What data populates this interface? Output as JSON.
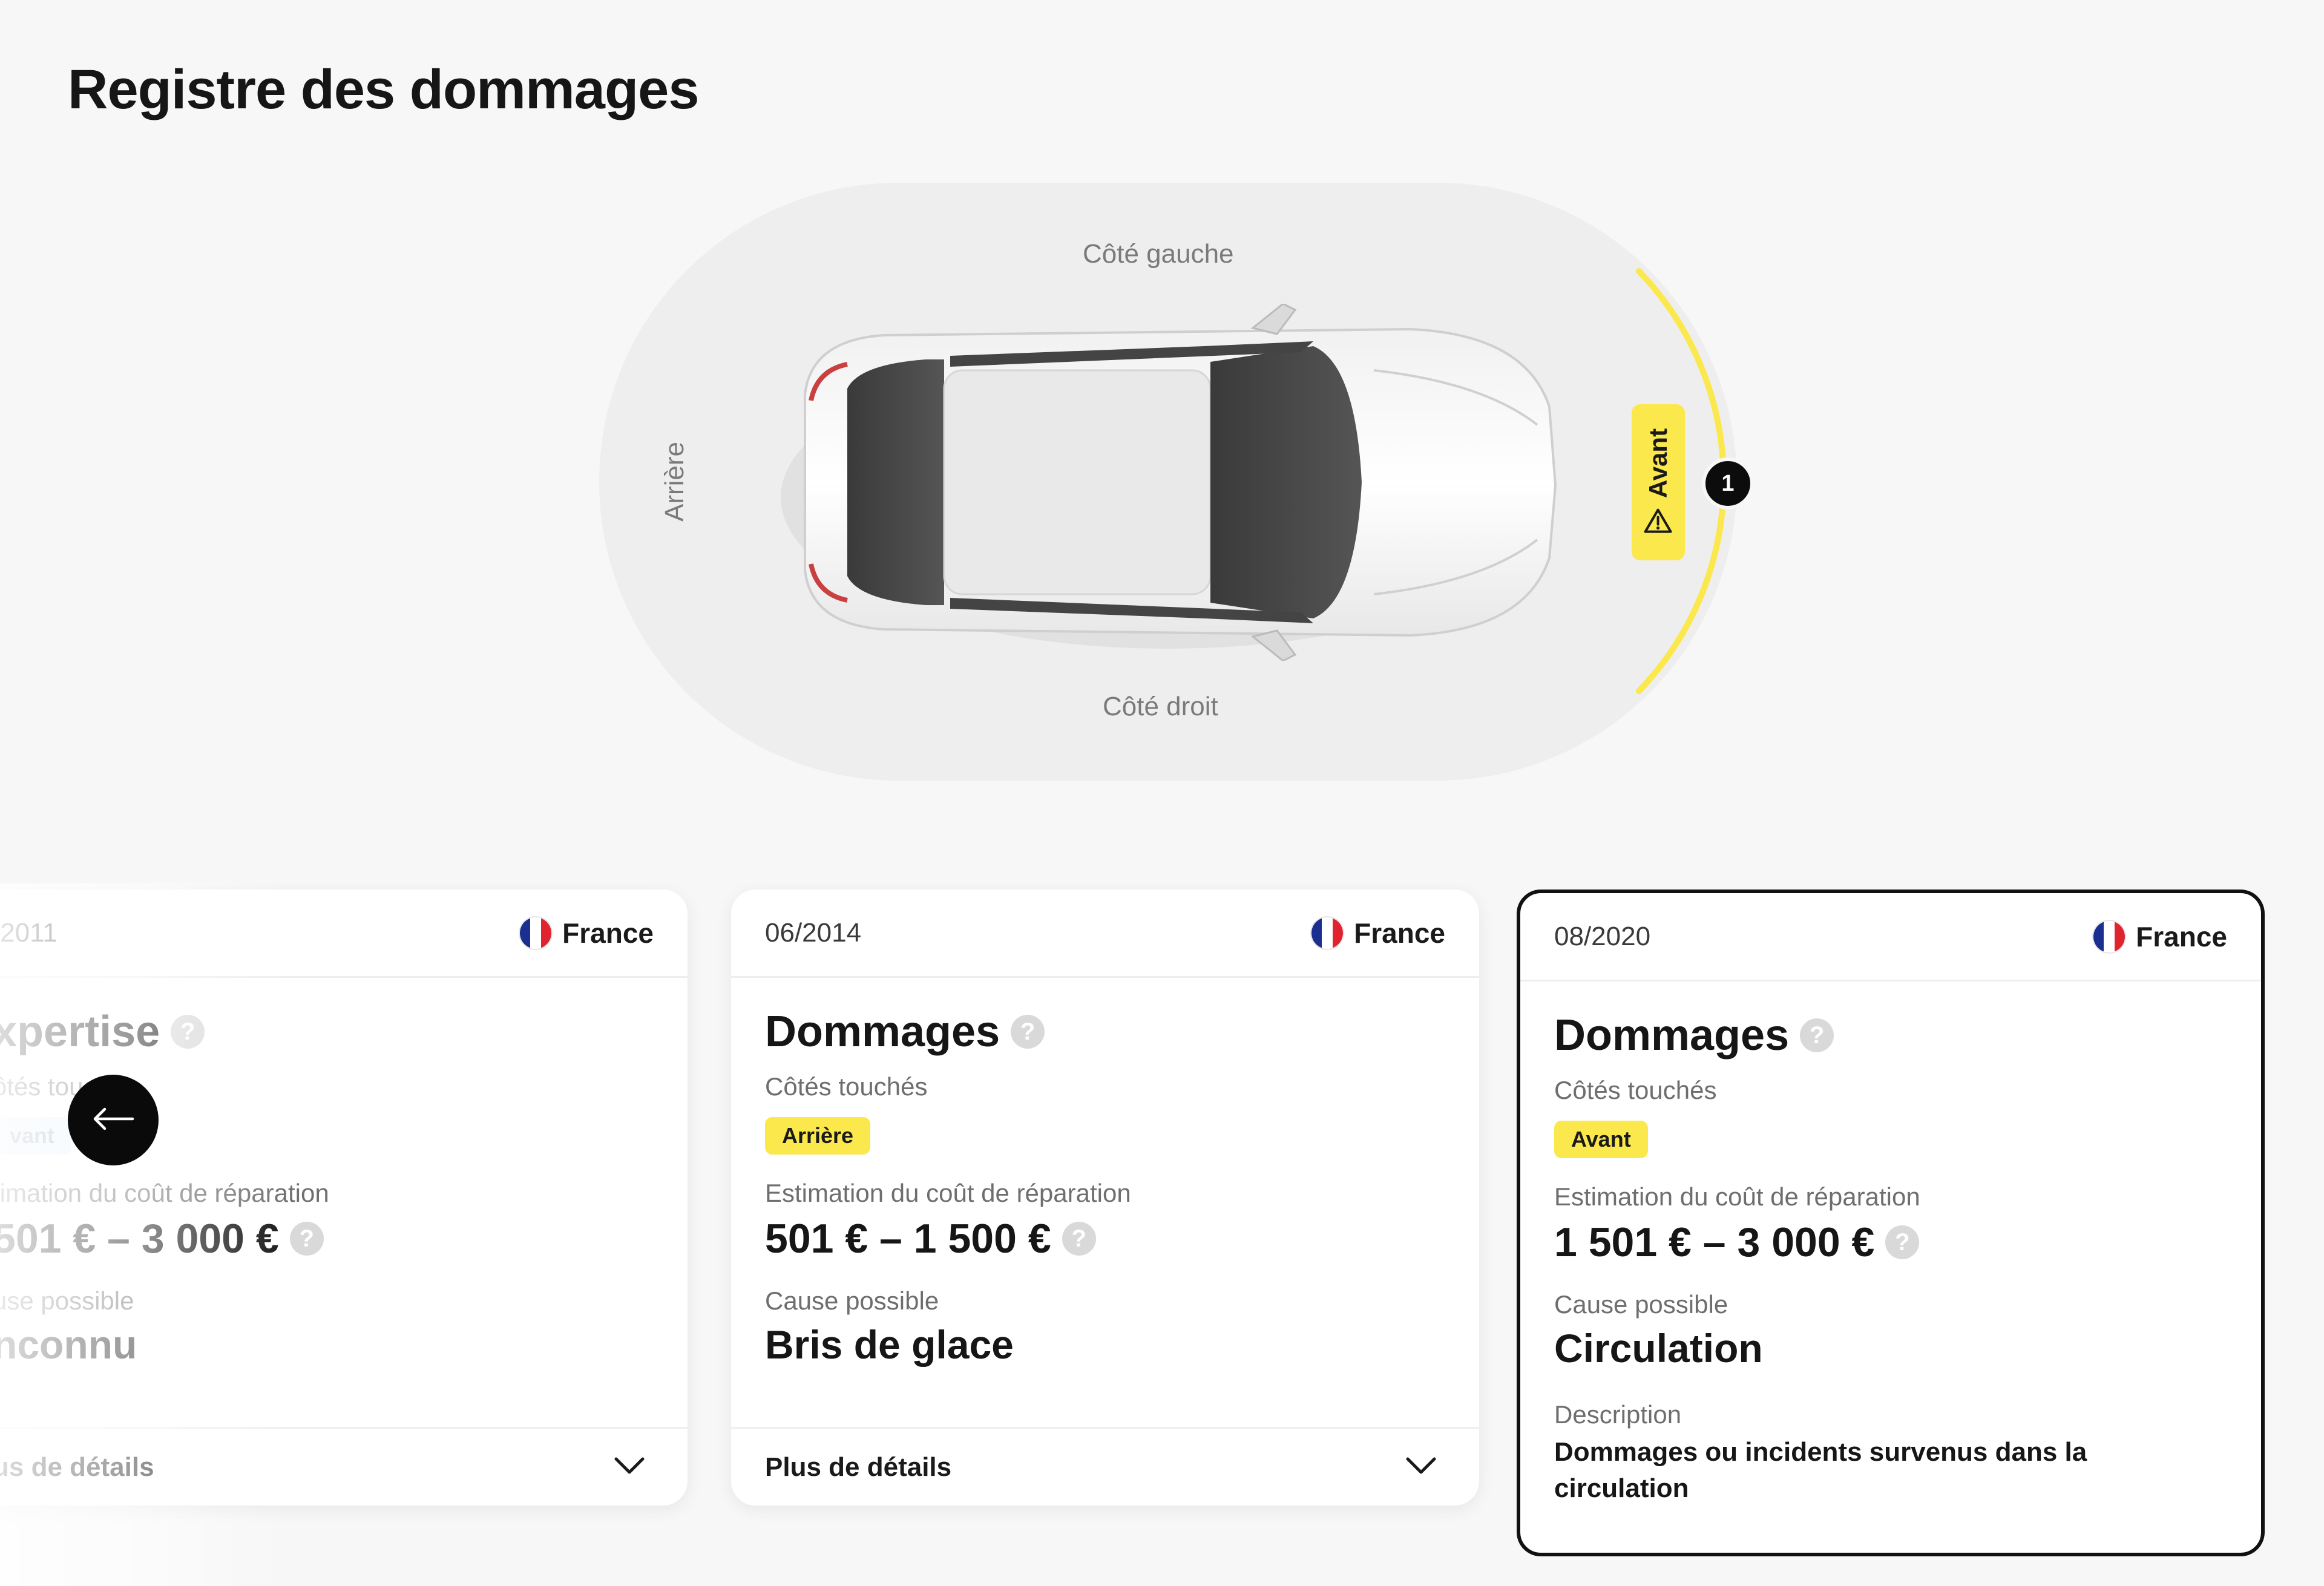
{
  "page": {
    "title": "Registre des dommages"
  },
  "diagram": {
    "labels": {
      "left": "Côté gauche",
      "right": "Côté droit",
      "rear": "Arrière"
    },
    "front_tag": {
      "label": "Avant",
      "icon": "warning-triangle-icon"
    },
    "front_count": "1",
    "highlight_color": "#fbe84d"
  },
  "cards": [
    {
      "date": "/2011",
      "country": "France",
      "title": "xpertise",
      "sides_label": "ôtés touchés",
      "sides_tag": "vant",
      "cost_label": "timation du coût de réparation",
      "cost_value": "501 € – 3 000 €",
      "cause_label": "use possible",
      "cause_value": "nconnu",
      "details_label": "us de détails"
    },
    {
      "date": "06/2014",
      "country": "France",
      "title": "Dommages",
      "sides_label": "Côtés touchés",
      "sides_tag": "Arrière",
      "cost_label": "Estimation du coût de réparation",
      "cost_value": "501 € – 1 500 €",
      "cause_label": "Cause possible",
      "cause_value": "Bris de glace",
      "details_label": "Plus de détails"
    },
    {
      "date": "08/2020",
      "country": "France",
      "title": "Dommages",
      "sides_label": "Côtés touchés",
      "sides_tag": "Avant",
      "cost_label": "Estimation du coût de réparation",
      "cost_value": "1 501 € – 3 000 €",
      "cause_label": "Cause possible",
      "cause_value": "Circulation",
      "description_label": "Description",
      "description": "Dommages ou incidents survenus dans la circulation"
    }
  ],
  "help_glyph": "?",
  "colors": {
    "tag_yellow": "#fbe84d",
    "accent_dark": "#0c0c0c"
  }
}
